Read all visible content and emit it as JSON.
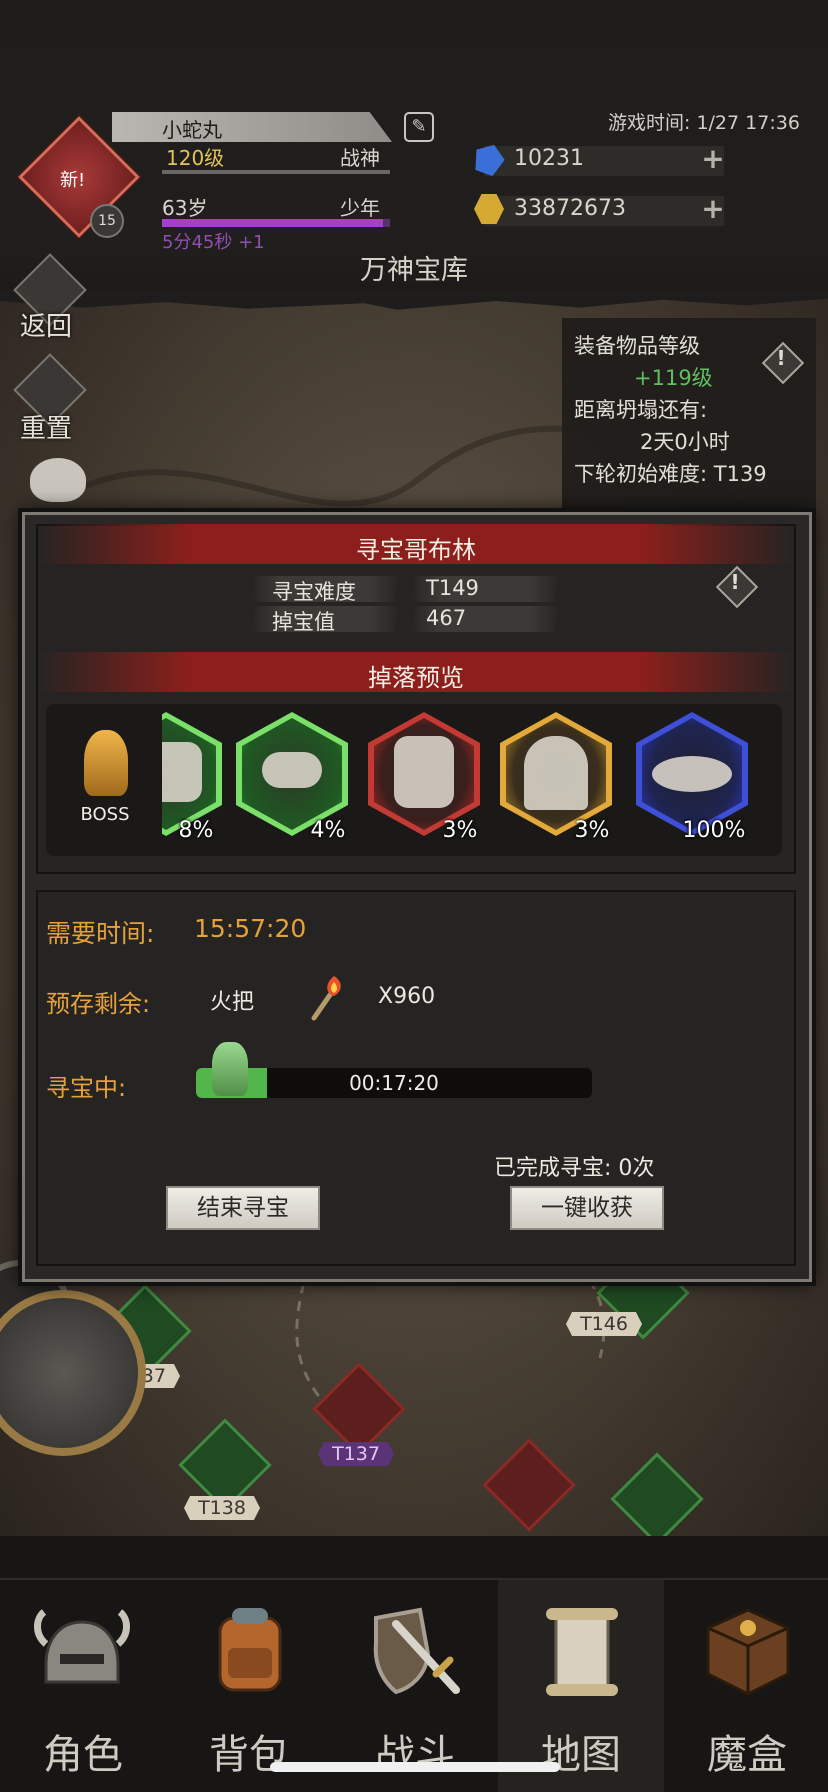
{
  "player": {
    "new_tag": "新!",
    "rank_badge": "15",
    "name": "小蛇丸",
    "level": "120级",
    "title": "战神",
    "age": "63岁",
    "age_stage": "少年",
    "age_timer": "5分45秒 +1",
    "age_progress": 0.97
  },
  "game_time": "游戏时间: 1/27 17:36",
  "currency": {
    "gems": "10231",
    "gold": "33872673"
  },
  "page_title": "万神宝库",
  "side_buttons": {
    "back": "返回",
    "reset": "重置"
  },
  "info_panel": {
    "equip_label": "装备物品等级",
    "equip_level": "+119级",
    "collapse_label": "距离坍塌还有:",
    "collapse_time": "2天0小时",
    "next_difficulty": "下轮初始难度: T139"
  },
  "map_nodes": [
    {
      "label": "T146"
    },
    {
      "label": "T137"
    },
    {
      "label": "T137"
    },
    {
      "label": "T138"
    }
  ],
  "dialog": {
    "title": "寻宝哥布林",
    "difficulty_label": "寻宝难度",
    "difficulty_value": "T149",
    "drop_label": "掉宝值",
    "drop_value": "467",
    "preview_title": "掉落预览",
    "boss_label": "BOSS",
    "drops": [
      {
        "rarity": "green",
        "percent": "8%",
        "icon": "armor-icon"
      },
      {
        "rarity": "green",
        "percent": "4%",
        "icon": "belt-icon"
      },
      {
        "rarity": "red",
        "percent": "3%",
        "icon": "armor-icon"
      },
      {
        "rarity": "gold",
        "percent": "3%",
        "icon": "robe-icon"
      },
      {
        "rarity": "blue",
        "percent": "100%",
        "icon": "bowl-icon"
      }
    ],
    "time_label": "需要时间:",
    "time_value": "15:57:20",
    "stock_label": "预存剩余:",
    "stock_item": "火把",
    "stock_count": "X960",
    "searching_label": "寻宝中:",
    "progress_time": "00:17:20",
    "progress": 0.18,
    "completed": "已完成寻宝:  0次",
    "end_button": "结束寻宝",
    "collect_button": "一键收获"
  },
  "nav": [
    {
      "label": "角色",
      "icon": "helmet-icon"
    },
    {
      "label": "背包",
      "icon": "backpack-icon"
    },
    {
      "label": "战斗",
      "icon": "sword-shield-icon"
    },
    {
      "label": "地图",
      "icon": "scroll-map-icon",
      "active": true
    },
    {
      "label": "魔盒",
      "icon": "magic-box-icon"
    }
  ],
  "colors": {
    "accent_orange": "#e6a23a",
    "rarity_green": "#7ae06a",
    "rarity_red": "#c33a35",
    "rarity_gold": "#e3a93a",
    "rarity_blue": "#3e4fd8",
    "level_green": "#5ec05e"
  }
}
